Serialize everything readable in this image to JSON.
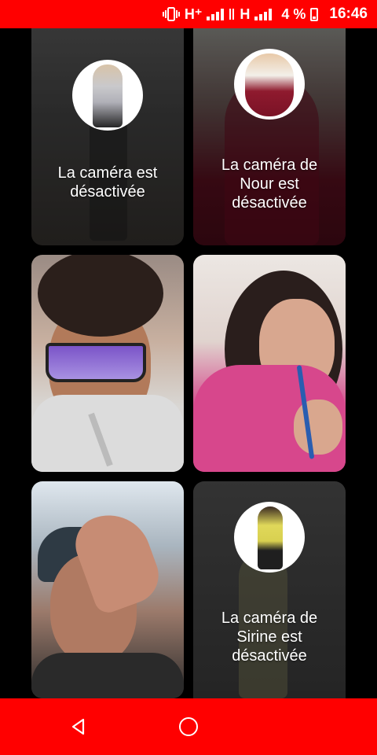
{
  "status_bar": {
    "network_1": "H⁺",
    "network_2": "H",
    "battery": "4 %",
    "time": "16:46",
    "icons": [
      "vibrate-icon",
      "signal-icon",
      "signal-icon",
      "battery-charging-icon"
    ]
  },
  "participants": [
    {
      "tile": 1,
      "state": "camera-off",
      "label": "La caméra est désactivée"
    },
    {
      "tile": 2,
      "state": "camera-off",
      "label": "La caméra de Nour est désactivée"
    },
    {
      "tile": 3,
      "state": "video"
    },
    {
      "tile": 4,
      "state": "video"
    },
    {
      "tile": 5,
      "state": "video"
    },
    {
      "tile": 6,
      "state": "camera-off",
      "label": "La caméra de Sirine est désactivée"
    }
  ],
  "nav_bar": {
    "icons": [
      "back-icon",
      "home-icon"
    ]
  },
  "colors": {
    "status_bar": "#ff0000",
    "nav_bar": "#ff0000",
    "background": "#000000"
  }
}
